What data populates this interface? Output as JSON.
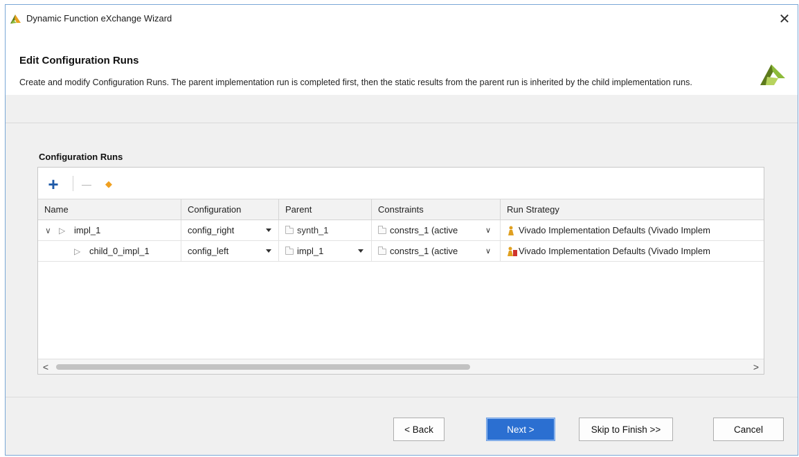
{
  "window": {
    "title": "Dynamic Function eXchange Wizard",
    "close_label": "✕"
  },
  "header": {
    "title": "Edit Configuration Runs",
    "description": "Create and modify Configuration Runs. The parent implementation run is completed first, then the static results from the parent run is inherited by the child implementation runs."
  },
  "section": {
    "label": "Configuration Runs"
  },
  "toolbar": {
    "add_label": "+",
    "remove_label": "—",
    "set_active_label": "◆"
  },
  "table": {
    "columns": [
      "Name",
      "Configuration",
      "Parent",
      "Constraints",
      "Run Strategy"
    ],
    "rows": [
      {
        "expander": "∨",
        "run_icon": "▷",
        "name": "impl_1",
        "configuration": "config_right",
        "parent": "synth_1",
        "constraints": "constrs_1 (active",
        "strategy": "Vivado Implementation Defaults (Vivado Implem"
      },
      {
        "expander": "",
        "run_icon": "▷",
        "name": "child_0_impl_1",
        "configuration": "config_left",
        "parent": "impl_1",
        "constraints": "constrs_1 (active",
        "strategy": "Vivado Implementation Defaults (Vivado Implem"
      }
    ],
    "scroll_left": "<",
    "scroll_right": ">"
  },
  "buttons": {
    "back": "< Back",
    "next": "Next >",
    "skip": "Skip to Finish >>",
    "cancel": "Cancel"
  },
  "colors": {
    "window_border": "#7aa7d6",
    "accent_blue": "#2b6fd1",
    "add_icon": "#1f5aa8",
    "set_active_icon": "#f0a020",
    "logo_green": "#8dbb3a",
    "logo_olive": "#5d7a1d"
  }
}
